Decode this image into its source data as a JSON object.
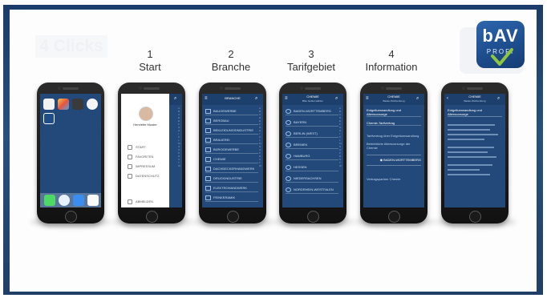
{
  "slide": {
    "ghost_title": "4 Clicks",
    "logo": {
      "brand": "bAV",
      "sub": "PROFI"
    },
    "steps": [
      {
        "num": "1",
        "label": "Start"
      },
      {
        "num": "2",
        "label": "Branche"
      },
      {
        "num": "3",
        "label": "Tarifgebiet"
      },
      {
        "num": "4",
        "label": "Information"
      }
    ]
  },
  "phones": {
    "menu": {
      "name": "Henriette Muster",
      "items": [
        "START",
        "FAVORITEN",
        "IMPRESSUM",
        "DATENSCHUTZ"
      ],
      "footer": "ABMELDEN"
    },
    "branche": {
      "title": "BRANCHE",
      "rows": [
        "BAUGEWERBE",
        "BERGBAU",
        "BEKLEIDUNGSINDUSTRIE",
        "BRAUEREI",
        "BÜROGEWERBE",
        "CHEMIE",
        "DACHDECKERHANDWERK",
        "DRUCKINDUSTRIE",
        "ELEKTROHANDWERK",
        "FEINKERAMIK"
      ]
    },
    "tarif": {
      "title": "CHEMIE",
      "subtitle": "Bitte Gebiet wählen",
      "rows": [
        "BADEN-WÜRTTEMBERG",
        "BAYERN",
        "BERLIN (WEST)",
        "BREMEN",
        "HAMBURG",
        "HESSEN",
        "NIEDERSACHSEN",
        "NORDRHEIN-WESTFALEN"
      ]
    },
    "info": {
      "title": "CHEMIE",
      "subtitle": "Baden-Württemberg",
      "rows": [
        "Entgeltumwandlung und Altersvorsorge",
        "Chemie-Tarifvertrag",
        "Tarifvertrag über Entgeltumwandlung",
        "Betriebliche Altersvorsorge der Chemie",
        "BADEN-WÜRTTEMBERG",
        "Vertragspartner Chemie"
      ]
    },
    "detail": {
      "title": "Entgeltumwandlung und Altersvorsorge"
    }
  }
}
